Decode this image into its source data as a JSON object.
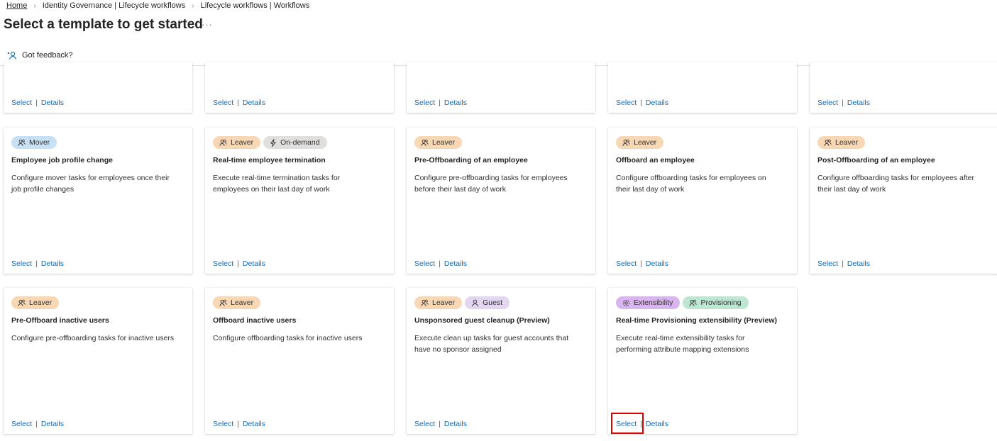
{
  "breadcrumb": {
    "items": [
      "Home",
      "Identity Governance | Lifecycle workflows",
      "Lifecycle workflows | Workflows"
    ]
  },
  "page": {
    "title": "Select a template to get started",
    "more": "···"
  },
  "feedback": {
    "label": "Got feedback?"
  },
  "links": {
    "select": "Select",
    "separator": "|",
    "details": "Details"
  },
  "tag_colors": {
    "Mover": "#c7e0f4",
    "Leaver": "#f8d7b4",
    "On-demand": "#e1dfdd",
    "Guest": "#e2d6f0",
    "Extensibility": "#d8b5ee",
    "Provisioning": "#bfe6d3"
  },
  "top_row_cards": [
    {
      "select": "Select",
      "details": "Details"
    },
    {
      "select": "Select",
      "details": "Details"
    },
    {
      "select": "Select",
      "details": "Details"
    },
    {
      "select": "Select",
      "details": "Details"
    },
    {
      "select": "Select",
      "details": "Details"
    }
  ],
  "templates": [
    {
      "tags": [
        {
          "label": "Mover",
          "icon": "people-icon"
        }
      ],
      "title": "Employee job profile change",
      "description": "Configure mover tasks for employees once their job profile changes"
    },
    {
      "tags": [
        {
          "label": "Leaver",
          "icon": "people-icon"
        },
        {
          "label": "On-demand",
          "icon": "lightning-icon"
        }
      ],
      "title": "Real-time employee termination",
      "description": "Execute real-time termination tasks for employees on their last day of work"
    },
    {
      "tags": [
        {
          "label": "Leaver",
          "icon": "people-icon"
        }
      ],
      "title": "Pre-Offboarding of an employee",
      "description": "Configure pre-offboarding tasks for employees before their last day of work"
    },
    {
      "tags": [
        {
          "label": "Leaver",
          "icon": "people-icon"
        }
      ],
      "title": "Offboard an employee",
      "description": "Configure offboarding tasks for employees on their last day of work"
    },
    {
      "tags": [
        {
          "label": "Leaver",
          "icon": "people-icon"
        }
      ],
      "title": "Post-Offboarding of an employee",
      "description": "Configure offboarding tasks for employees after their last day of work"
    },
    {
      "tags": [
        {
          "label": "Leaver",
          "icon": "people-icon"
        }
      ],
      "title": "Pre-Offboard inactive users",
      "description": "Configure pre-offboarding tasks for inactive users"
    },
    {
      "tags": [
        {
          "label": "Leaver",
          "icon": "people-icon"
        }
      ],
      "title": "Offboard inactive users",
      "description": "Configure offboarding tasks for inactive users"
    },
    {
      "tags": [
        {
          "label": "Leaver",
          "icon": "people-icon"
        },
        {
          "label": "Guest",
          "icon": "person-icon"
        }
      ],
      "title": "Unsponsored guest cleanup (Preview)",
      "description": "Execute clean up tasks for guest accounts that have no sponsor assigned"
    },
    {
      "tags": [
        {
          "label": "Extensibility",
          "icon": "gear-icon"
        },
        {
          "label": "Provisioning",
          "icon": "people-icon"
        }
      ],
      "title": "Real-time Provisioning extensibility (Preview)",
      "description": "Execute real-time extensibility tasks for performing attribute mapping extensions"
    }
  ]
}
